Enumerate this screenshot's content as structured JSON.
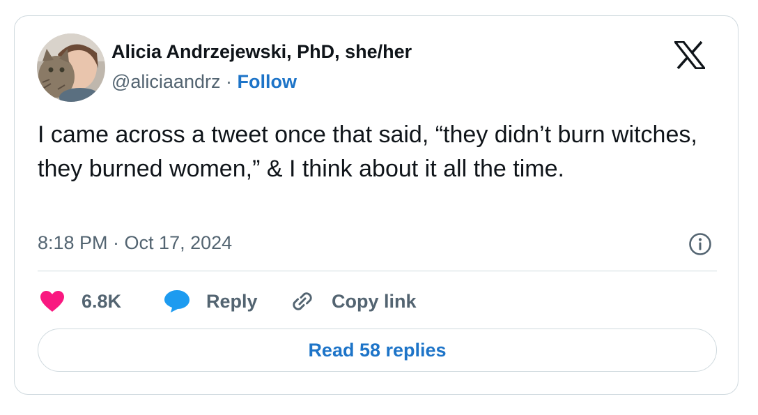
{
  "tweet": {
    "author": {
      "name": "Alicia Andrzejewski, PhD, she/her",
      "handle": "@aliciaandrz",
      "separator": "·",
      "follow_label": "Follow"
    },
    "text": "I came across a tweet once that said, “they didn’t burn witches, they burned women,” & I think about it all the time.",
    "timestamp": "8:18 PM · Oct 17, 2024",
    "actions": {
      "like_count": "6.8K",
      "reply_label": "Reply",
      "copy_link_label": "Copy link"
    },
    "read_replies_label": "Read 58 replies"
  },
  "icons": {
    "platform_logo": "x-logo-icon",
    "info": "info-icon",
    "like": "heart-icon",
    "reply": "speech-bubble-icon",
    "copy_link": "link-icon"
  },
  "colors": {
    "text_primary": "#0f1419",
    "text_secondary": "#536471",
    "link_blue": "#1d74c8",
    "like_pink": "#f91880",
    "reply_blue": "#1d9bf0",
    "border": "#cfd9de"
  }
}
